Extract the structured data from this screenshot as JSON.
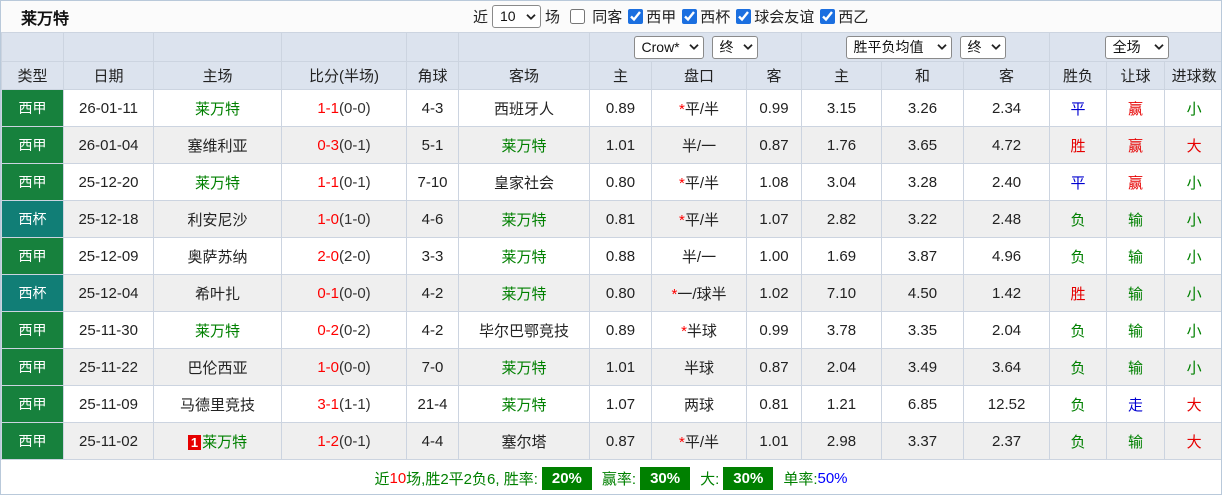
{
  "title": "莱万特",
  "toolbar": {
    "recent_label": "近",
    "recent_value": "10",
    "games_label": "场",
    "same_away_label": "同客",
    "same_away_checked": false,
    "filters": [
      {
        "label": "西甲",
        "checked": true
      },
      {
        "label": "西杯",
        "checked": true
      },
      {
        "label": "球会友谊",
        "checked": true
      },
      {
        "label": "西乙",
        "checked": true
      }
    ]
  },
  "table": {
    "selectors": {
      "handicap_company": "Crow*",
      "handicap_period": "终",
      "odds_source": "胜平负均值",
      "odds_period": "终",
      "scope": "全场"
    },
    "columns": {
      "type": "类型",
      "date": "日期",
      "home": "主场",
      "score": "比分(半场)",
      "corners": "角球",
      "away": "客场",
      "ah_home": "主",
      "ah_line": "盘口",
      "ah_away": "客",
      "avg_home": "主",
      "avg_draw": "和",
      "avg_away": "客",
      "result": "胜负",
      "handicap_result": "让球",
      "goals": "进球数"
    },
    "rows": [
      {
        "league": "西甲",
        "league_color": "green",
        "date": "26-01-11",
        "home": "莱万特",
        "home_highlight": true,
        "home_badge": "",
        "score": "1-1",
        "half": "(0-0)",
        "corners": "4-3",
        "away": "西班牙人",
        "away_highlight": false,
        "ah_home": "0.89",
        "ah_star": true,
        "ah_line": "平/半",
        "ah_away": "0.99",
        "avg_home": "3.15",
        "avg_draw": "3.26",
        "avg_away": "2.34",
        "result": {
          "text": "平",
          "color": "blue"
        },
        "handicap_result": {
          "text": "赢",
          "color": "red"
        },
        "goals": {
          "text": "小",
          "color": "green"
        }
      },
      {
        "league": "西甲",
        "league_color": "green",
        "date": "26-01-04",
        "home": "塞维利亚",
        "home_highlight": false,
        "home_badge": "",
        "score": "0-3",
        "half": "(0-1)",
        "corners": "5-1",
        "away": "莱万特",
        "away_highlight": true,
        "ah_home": "1.01",
        "ah_star": false,
        "ah_line": "半/一",
        "ah_away": "0.87",
        "avg_home": "1.76",
        "avg_draw": "3.65",
        "avg_away": "4.72",
        "result": {
          "text": "胜",
          "color": "red"
        },
        "handicap_result": {
          "text": "赢",
          "color": "red"
        },
        "goals": {
          "text": "大",
          "color": "red"
        }
      },
      {
        "league": "西甲",
        "league_color": "green",
        "date": "25-12-20",
        "home": "莱万特",
        "home_highlight": true,
        "home_badge": "",
        "score": "1-1",
        "half": "(0-1)",
        "corners": "7-10",
        "away": "皇家社会",
        "away_highlight": false,
        "ah_home": "0.80",
        "ah_star": true,
        "ah_line": "平/半",
        "ah_away": "1.08",
        "avg_home": "3.04",
        "avg_draw": "3.28",
        "avg_away": "2.40",
        "result": {
          "text": "平",
          "color": "blue"
        },
        "handicap_result": {
          "text": "赢",
          "color": "red"
        },
        "goals": {
          "text": "小",
          "color": "green"
        }
      },
      {
        "league": "西杯",
        "league_color": "teal",
        "date": "25-12-18",
        "home": "利安尼沙",
        "home_highlight": false,
        "home_badge": "",
        "score": "1-0",
        "half": "(1-0)",
        "corners": "4-6",
        "away": "莱万特",
        "away_highlight": true,
        "ah_home": "0.81",
        "ah_star": true,
        "ah_line": "平/半",
        "ah_away": "1.07",
        "avg_home": "2.82",
        "avg_draw": "3.22",
        "avg_away": "2.48",
        "result": {
          "text": "负",
          "color": "green"
        },
        "handicap_result": {
          "text": "输",
          "color": "green"
        },
        "goals": {
          "text": "小",
          "color": "green"
        }
      },
      {
        "league": "西甲",
        "league_color": "green",
        "date": "25-12-09",
        "home": "奥萨苏纳",
        "home_highlight": false,
        "home_badge": "",
        "score": "2-0",
        "half": "(2-0)",
        "corners": "3-3",
        "away": "莱万特",
        "away_highlight": true,
        "ah_home": "0.88",
        "ah_star": false,
        "ah_line": "半/一",
        "ah_away": "1.00",
        "avg_home": "1.69",
        "avg_draw": "3.87",
        "avg_away": "4.96",
        "result": {
          "text": "负",
          "color": "green"
        },
        "handicap_result": {
          "text": "输",
          "color": "green"
        },
        "goals": {
          "text": "小",
          "color": "green"
        }
      },
      {
        "league": "西杯",
        "league_color": "teal",
        "date": "25-12-04",
        "home": "希叶扎",
        "home_highlight": false,
        "home_badge": "",
        "score": "0-1",
        "half": "(0-0)",
        "corners": "4-2",
        "away": "莱万特",
        "away_highlight": true,
        "ah_home": "0.80",
        "ah_star": true,
        "ah_line": "一/球半",
        "ah_away": "1.02",
        "avg_home": "7.10",
        "avg_draw": "4.50",
        "avg_away": "1.42",
        "result": {
          "text": "胜",
          "color": "red"
        },
        "handicap_result": {
          "text": "输",
          "color": "green"
        },
        "goals": {
          "text": "小",
          "color": "green"
        }
      },
      {
        "league": "西甲",
        "league_color": "green",
        "date": "25-11-30",
        "home": "莱万特",
        "home_highlight": true,
        "home_badge": "",
        "score": "0-2",
        "half": "(0-2)",
        "corners": "4-2",
        "away": "毕尔巴鄂竞技",
        "away_highlight": false,
        "ah_home": "0.89",
        "ah_star": true,
        "ah_line": "半球",
        "ah_away": "0.99",
        "avg_home": "3.78",
        "avg_draw": "3.35",
        "avg_away": "2.04",
        "result": {
          "text": "负",
          "color": "green"
        },
        "handicap_result": {
          "text": "输",
          "color": "green"
        },
        "goals": {
          "text": "小",
          "color": "green"
        }
      },
      {
        "league": "西甲",
        "league_color": "green",
        "date": "25-11-22",
        "home": "巴伦西亚",
        "home_highlight": false,
        "home_badge": "",
        "score": "1-0",
        "half": "(0-0)",
        "corners": "7-0",
        "away": "莱万特",
        "away_highlight": true,
        "ah_home": "1.01",
        "ah_star": false,
        "ah_line": "半球",
        "ah_away": "0.87",
        "avg_home": "2.04",
        "avg_draw": "3.49",
        "avg_away": "3.64",
        "result": {
          "text": "负",
          "color": "green"
        },
        "handicap_result": {
          "text": "输",
          "color": "green"
        },
        "goals": {
          "text": "小",
          "color": "green"
        }
      },
      {
        "league": "西甲",
        "league_color": "green",
        "date": "25-11-09",
        "home": "马德里竞技",
        "home_highlight": false,
        "home_badge": "",
        "score": "3-1",
        "half": "(1-1)",
        "corners": "21-4",
        "away": "莱万特",
        "away_highlight": true,
        "ah_home": "1.07",
        "ah_star": false,
        "ah_line": "两球",
        "ah_away": "0.81",
        "avg_home": "1.21",
        "avg_draw": "6.85",
        "avg_away": "12.52",
        "result": {
          "text": "负",
          "color": "green"
        },
        "handicap_result": {
          "text": "走",
          "color": "blue"
        },
        "goals": {
          "text": "大",
          "color": "red"
        }
      },
      {
        "league": "西甲",
        "league_color": "green",
        "date": "25-11-02",
        "home": "莱万特",
        "home_highlight": true,
        "home_badge": "1",
        "score": "1-2",
        "half": "(0-1)",
        "corners": "4-4",
        "away": "塞尔塔",
        "away_highlight": false,
        "ah_home": "0.87",
        "ah_star": true,
        "ah_line": "平/半",
        "ah_away": "1.01",
        "avg_home": "2.98",
        "avg_draw": "3.37",
        "avg_away": "2.37",
        "result": {
          "text": "负",
          "color": "green"
        },
        "handicap_result": {
          "text": "输",
          "color": "green"
        },
        "goals": {
          "text": "大",
          "color": "red"
        }
      }
    ]
  },
  "summary": {
    "recent_label": "近",
    "recent_count": "10",
    "stats_text": "场,胜2平2负6, 胜率:",
    "win_rate": "20%",
    "win_odds_label": "赢率:",
    "win_odds_rate": "30%",
    "big_label": "大:",
    "big_rate": "30%",
    "single_label": "单率:",
    "single_rate": "50%"
  }
}
